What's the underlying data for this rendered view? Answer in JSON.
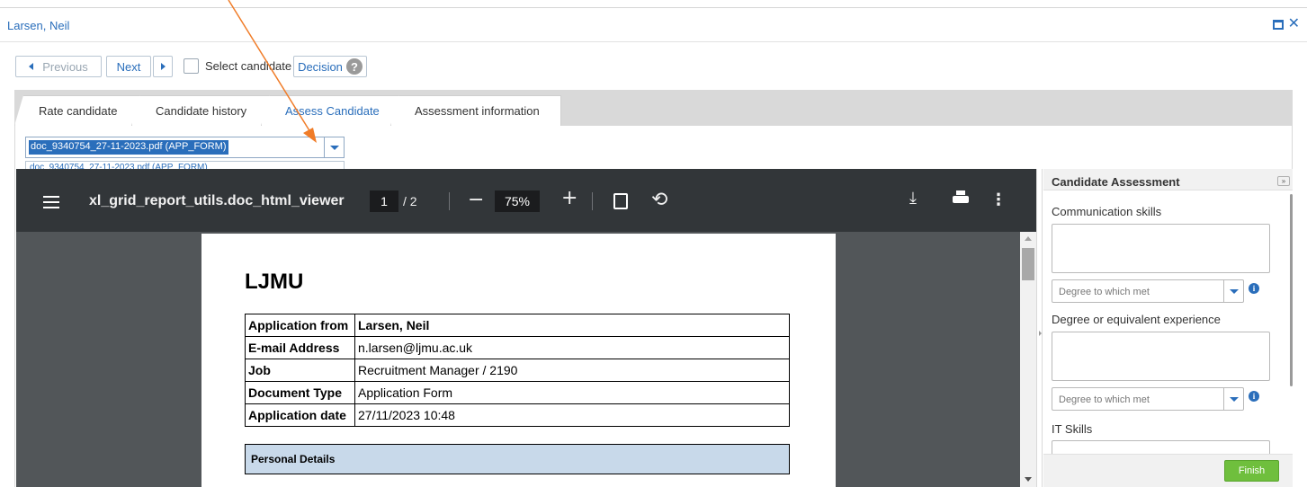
{
  "window": {
    "title": "Larsen, Neil"
  },
  "toolbar": {
    "previous_label": "Previous",
    "next_label": "Next",
    "select_label": "Select candidate",
    "decision_label": "Decision",
    "decision_help": "?"
  },
  "tabs": [
    {
      "label": "Rate candidate",
      "active": false
    },
    {
      "label": "Candidate history",
      "active": false
    },
    {
      "label": "Assess Candidate",
      "active": true
    },
    {
      "label": "Assessment information",
      "active": false
    }
  ],
  "document_select": {
    "selected": "doc_9340754_27-11-2023.pdf (APP_FORM)",
    "options": [
      "doc_9340754_27-11-2023.pdf (APP_FORM)"
    ]
  },
  "viewer": {
    "title": "xl_grid_report_utils.doc_html_viewer",
    "page_current": "1",
    "page_total": "/ 2",
    "zoom": "75%",
    "zoom_minus": "−",
    "zoom_plus": "+",
    "rotate_glyph": "⟲",
    "download_glyph": "⤓",
    "kebab_glyph": "⋮"
  },
  "document": {
    "logo_text": "LJMU",
    "rows": [
      {
        "key": "Application from",
        "value": "Larsen, Neil",
        "bold": true
      },
      {
        "key": "E-mail Address",
        "value": "n.larsen@ljmu.ac.uk",
        "bold": false
      },
      {
        "key": "Job",
        "value": "Recruitment Manager / 2190",
        "bold": false
      },
      {
        "key": "Document Type",
        "value": "Application Form",
        "bold": false
      },
      {
        "key": "Application date",
        "value": "27/11/2023 10:48",
        "bold": false
      }
    ],
    "section_title": "Personal Details"
  },
  "panel": {
    "title": "Candidate Assessment",
    "collapse_glyph": "»",
    "criteria": [
      {
        "label": "Communication skills",
        "select_placeholder": "Degree to which met"
      },
      {
        "label": "Degree or equivalent experience",
        "select_placeholder": "Degree to which met"
      },
      {
        "label": "IT Skills",
        "select_placeholder": ""
      }
    ],
    "info_glyph": "i",
    "finish_label": "Finish"
  },
  "colors": {
    "accent": "#2a6ebb",
    "annotation_arrow": "#f07c28",
    "finish_green": "#6fbf3d",
    "viewer_toolbar": "#323639",
    "section_fill": "#c8d9ea"
  }
}
